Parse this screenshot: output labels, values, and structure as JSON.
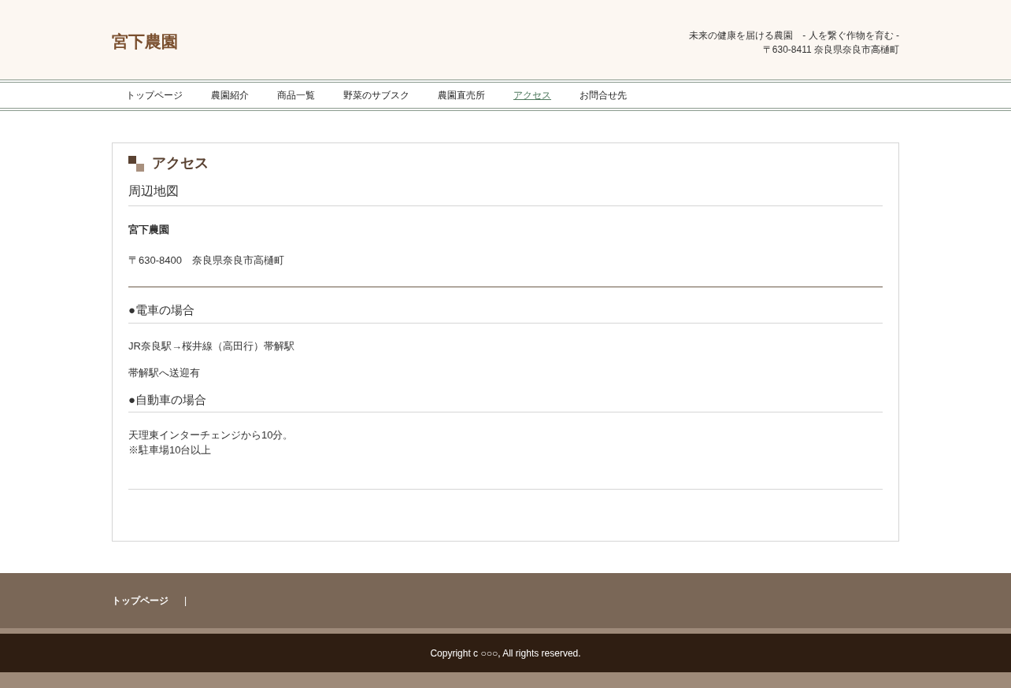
{
  "header": {
    "logo": "宮下農園",
    "tagline": "未来の健康を届ける農園　- 人を繋ぐ作物を育む -",
    "address": "〒630-8411 奈良県奈良市高樋町"
  },
  "nav": [
    {
      "label": "トップページ",
      "selected": false
    },
    {
      "label": "農園紹介",
      "selected": false
    },
    {
      "label": "商品一覧",
      "selected": false
    },
    {
      "label": "野菜のサブスク",
      "selected": false
    },
    {
      "label": "農園直売所",
      "selected": false
    },
    {
      "label": "アクセス",
      "selected": true
    },
    {
      "label": "お問合せ先",
      "selected": false
    }
  ],
  "page_title": "アクセス",
  "map_section": {
    "heading": "周辺地図",
    "name": "宮下農園",
    "address": "〒630-8400　奈良県奈良市高樋町"
  },
  "sections": [
    {
      "heading": "●電車の場合",
      "paragraphs": [
        [
          "JR奈良駅→桜井線（高田行）帯解駅"
        ],
        [
          "帯解駅へ送迎有"
        ]
      ]
    },
    {
      "heading": "●自動車の場合",
      "paragraphs": [
        [
          "天理東インターチェンジから10分。",
          "※駐車場10台以上"
        ]
      ]
    }
  ],
  "footer": {
    "links": [
      {
        "label": "トップページ"
      }
    ],
    "separator": "|",
    "copyright": "Copyright c ○○○, All rights reserved."
  }
}
